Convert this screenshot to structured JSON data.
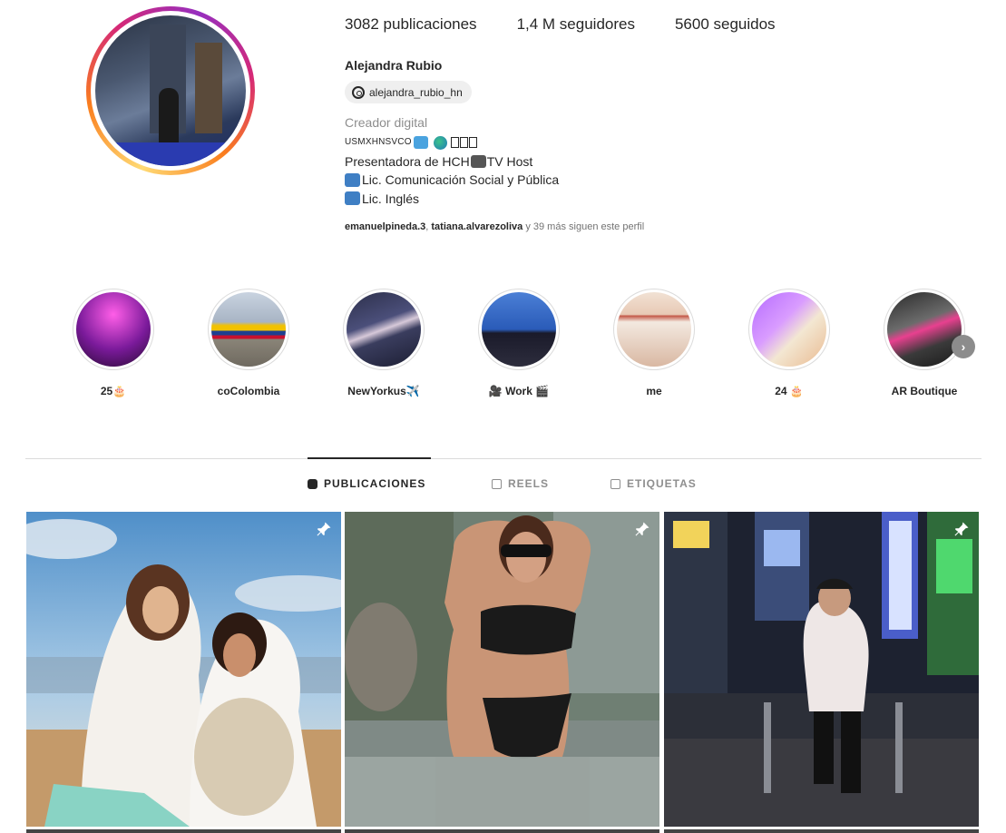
{
  "profile": {
    "posts": "3082 publicaciones",
    "followers": "1,4 M seguidores",
    "following": "5600 seguidos",
    "name": "Alejandra Rubio",
    "threads_handle": "alejandra_rubio_hn",
    "category": "Creador digital",
    "bio_line1_text": "USMXHNSVCO",
    "bio_line2a": "Presentadora de HCH",
    "bio_line2b": "TV Host",
    "bio_line3": "Lic. Comunicación Social y Pública",
    "bio_line4": "Lic. Inglés",
    "followed_by_1": "emanuelpineda.3",
    "followed_by_sep": ", ",
    "followed_by_2": "tatiana.alvarezoliva",
    "followed_by_rest": " y 39 más siguen este perfil"
  },
  "highlights": [
    {
      "label": "25🎂"
    },
    {
      "label": "coColombia"
    },
    {
      "label": "NewYorkus✈️"
    },
    {
      "label": "🎥 Work 🎬"
    },
    {
      "label": "me"
    },
    {
      "label": "24 🎂"
    },
    {
      "label": "AR Boutique"
    }
  ],
  "tabs": [
    {
      "label": "PUBLICACIONES"
    },
    {
      "label": "REELS"
    },
    {
      "label": "ETIQUETAS"
    }
  ],
  "colors": {
    "text": "#262626",
    "muted": "#8e8e8e",
    "ring_start": "#feda75",
    "ring_mid": "#d62976",
    "ring_end": "#962fbf"
  },
  "icons": {
    "threads": "threads-icon",
    "pin": "pin-icon",
    "next": "chevron-right-icon",
    "grid": "grid-icon",
    "reels": "reels-icon",
    "tagged": "tagged-icon"
  }
}
